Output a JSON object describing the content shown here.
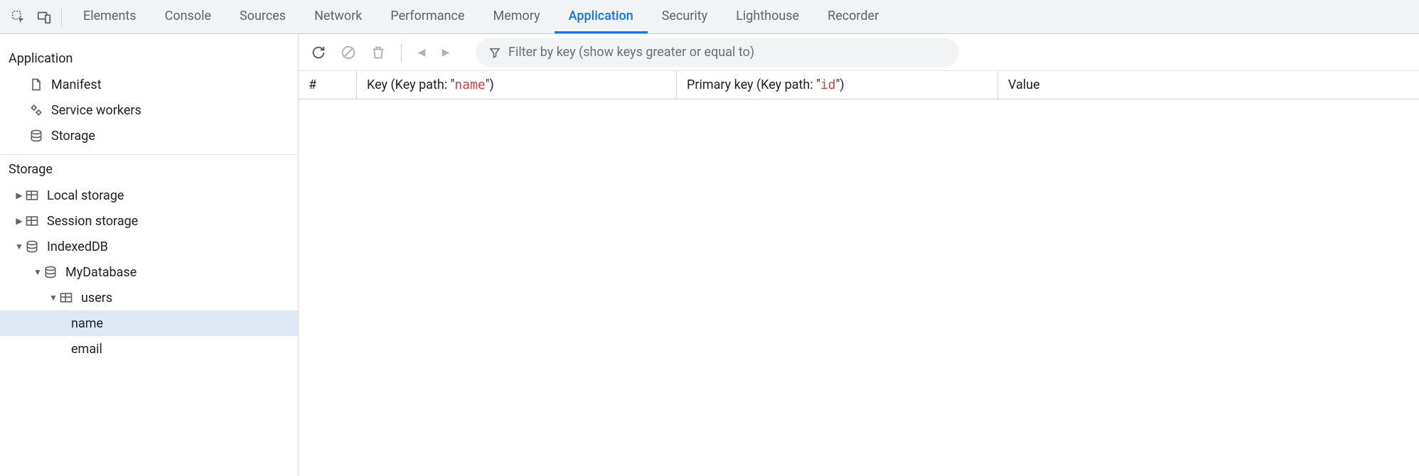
{
  "tabs": [
    {
      "label": "Elements",
      "active": false
    },
    {
      "label": "Console",
      "active": false
    },
    {
      "label": "Sources",
      "active": false
    },
    {
      "label": "Network",
      "active": false
    },
    {
      "label": "Performance",
      "active": false
    },
    {
      "label": "Memory",
      "active": false
    },
    {
      "label": "Application",
      "active": true
    },
    {
      "label": "Security",
      "active": false
    },
    {
      "label": "Lighthouse",
      "active": false
    },
    {
      "label": "Recorder",
      "active": false
    }
  ],
  "sidebar": {
    "application": {
      "title": "Application",
      "manifest": "Manifest",
      "service_workers": "Service workers",
      "storage": "Storage"
    },
    "storage": {
      "title": "Storage",
      "local_storage": "Local storage",
      "session_storage": "Session storage",
      "indexeddb": "IndexedDB",
      "database": "MyDatabase",
      "store": "users",
      "index_name": "name",
      "index_email": "email"
    }
  },
  "toolbar": {
    "filter_placeholder": "Filter by key (show keys greater or equal to)"
  },
  "table": {
    "index_col": "#",
    "key_prefix": "Key (Key path: \"",
    "key_path": "name",
    "key_suffix": "\")",
    "primary_prefix": "Primary key (Key path: \"",
    "primary_path": "id",
    "primary_suffix": "\")",
    "value_col": "Value"
  }
}
